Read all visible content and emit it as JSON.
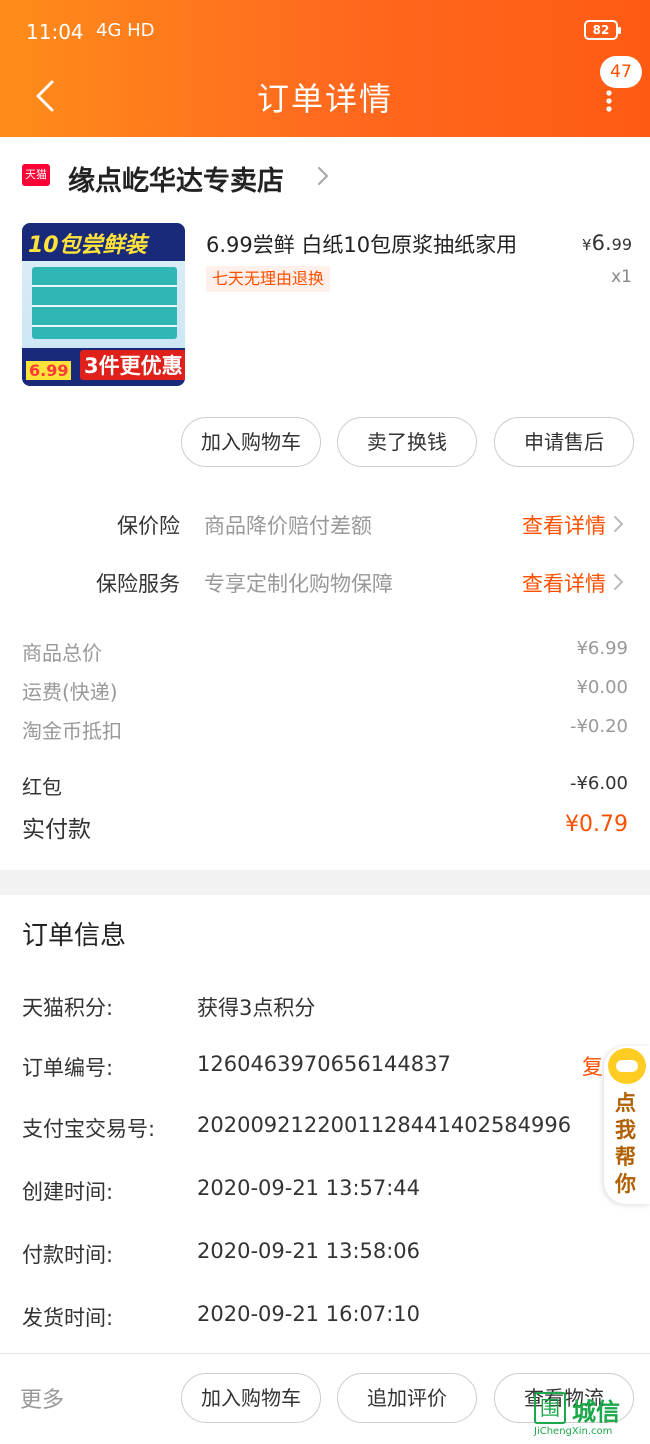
{
  "status_bar": {
    "time": "11:04",
    "network": "4G HD",
    "battery": "82"
  },
  "header": {
    "title": "订单详情",
    "badge": "47"
  },
  "shop": {
    "logo": "天猫",
    "name": "缘点屹华达专卖店"
  },
  "product": {
    "image_text_top": "10包尝鲜装",
    "image_price_tag": "6.99",
    "image_text_bottom": "3件更优惠",
    "title": "6.99尝鲜 白纸10包原浆抽纸家用",
    "price_symbol": "¥",
    "price_int": "6.",
    "price_dec": "99",
    "quantity": "x1",
    "tag": "七天无理由退换"
  },
  "actions": {
    "add_cart": "加入购物车",
    "resell": "卖了换钱",
    "after_sale": "申请售后"
  },
  "services": [
    {
      "label": "保价险",
      "desc": "商品降价赔付差额",
      "link": "查看详情"
    },
    {
      "label": "保险服务",
      "desc": "专享定制化购物保障",
      "link": "查看详情"
    }
  ],
  "summary": {
    "goods_total_label": "商品总价",
    "goods_total": "¥6.99",
    "shipping_label": "运费(快递)",
    "shipping": "¥0.00",
    "coins_label": "淘金币抵扣",
    "coins": "-¥0.20",
    "redpacket_label": "红包",
    "redpacket": "-¥6.00",
    "paid_label": "实付款",
    "paid": "¥0.79"
  },
  "order_info": {
    "title": "订单信息",
    "rows": [
      {
        "label": "天猫积分:",
        "value": "获得3点积分"
      },
      {
        "label": "订单编号:",
        "value": "1260463970656144837"
      },
      {
        "label": "支付宝交易号:",
        "value": "2020092122001128441402584996"
      },
      {
        "label": "创建时间:",
        "value": "2020-09-21 13:57:44"
      },
      {
        "label": "付款时间:",
        "value": "2020-09-21 13:58:06"
      },
      {
        "label": "发货时间:",
        "value": "2020-09-21 16:07:10"
      }
    ],
    "copy": "复"
  },
  "helper": {
    "text": "点我帮你"
  },
  "bottom_bar": {
    "more": "更多",
    "add_cart": "加入购物车",
    "add_review": "追加评价",
    "logistics": "查看物流"
  },
  "watermark": {
    "char": "围",
    "name": "城信",
    "url": "JiChengXin.com"
  },
  "colors": {
    "header_start": "#ff8c1a",
    "header_end": "#ff5a14",
    "accent": "#ff5000"
  }
}
